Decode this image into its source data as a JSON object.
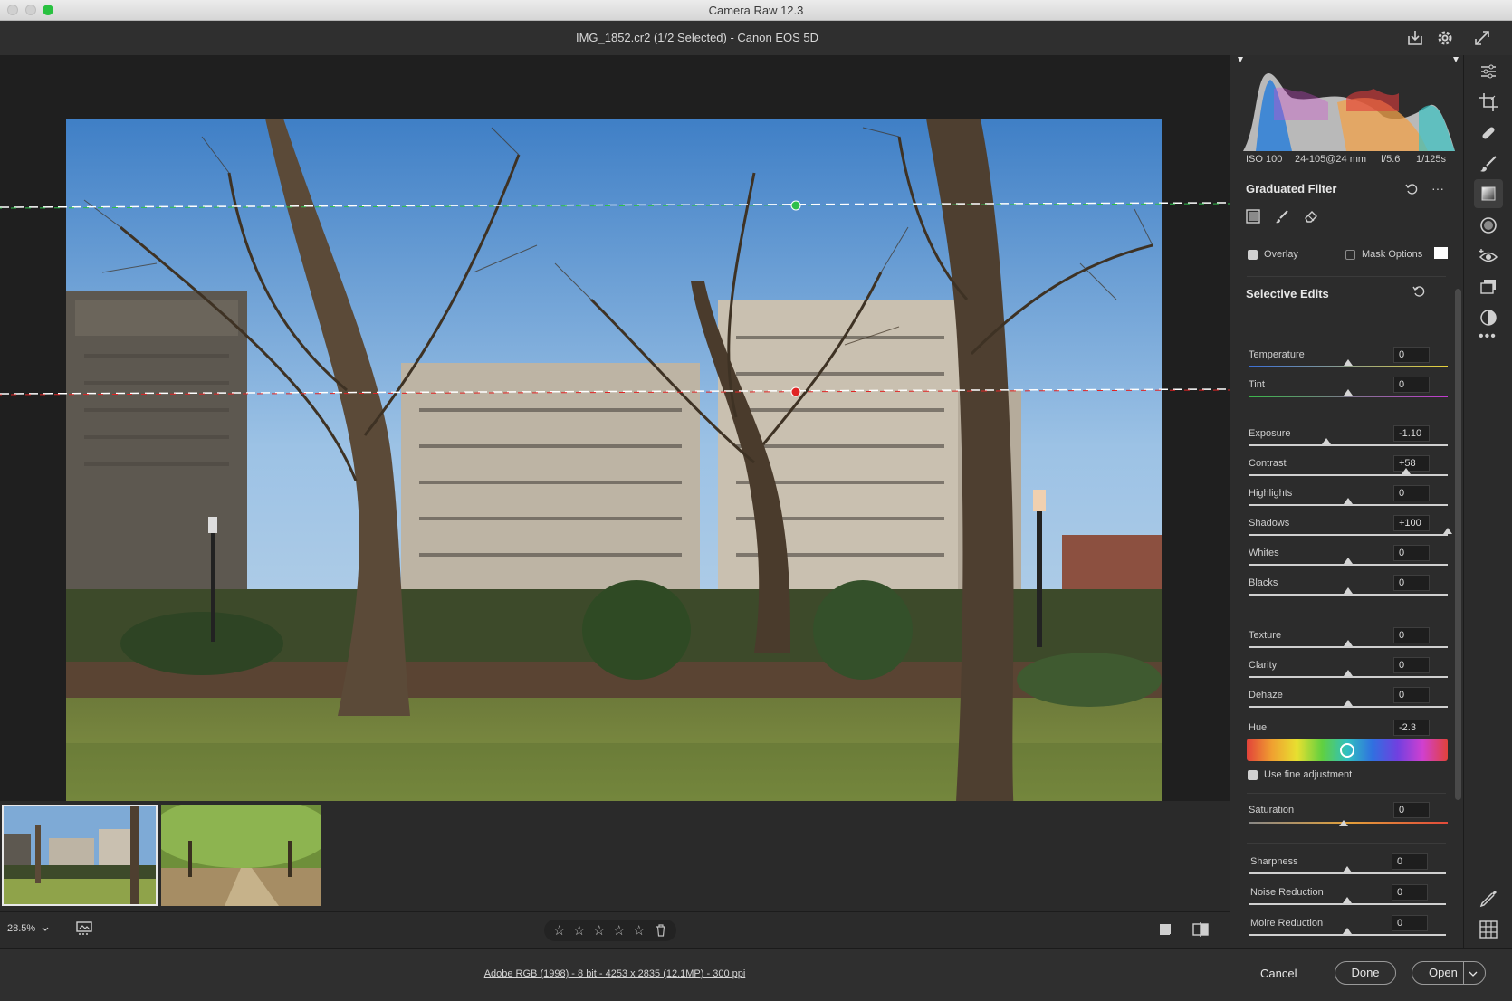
{
  "window": {
    "title": "Camera Raw 12.3"
  },
  "header": {
    "document_title": "IMG_1852.cr2 (1/2 Selected)  -  Canon EOS 5D"
  },
  "histogram": {
    "iso": "ISO 100",
    "lens": "24-105@24 mm",
    "aperture": "f/5.6",
    "shutter": "1/125s"
  },
  "graduated_filter": {
    "title": "Graduated Filter",
    "overlay_label": "Overlay",
    "overlay_checked": true,
    "mask_options_label": "Mask Options",
    "mask_options_checked": false
  },
  "selective_edits": {
    "title": "Selective Edits",
    "sliders": [
      {
        "label": "Temperature",
        "value": "0",
        "position": 0.5
      },
      {
        "label": "Tint",
        "value": "0",
        "position": 0.5
      },
      {
        "label": "Exposure",
        "value": "-1.10",
        "position": 0.39
      },
      {
        "label": "Contrast",
        "value": "+58",
        "position": 0.79
      },
      {
        "label": "Highlights",
        "value": "0",
        "position": 0.5
      },
      {
        "label": "Shadows",
        "value": "+100",
        "position": 1.0
      },
      {
        "label": "Whites",
        "value": "0",
        "position": 0.5
      },
      {
        "label": "Blacks",
        "value": "0",
        "position": 0.5
      },
      {
        "label": "Texture",
        "value": "0",
        "position": 0.5
      },
      {
        "label": "Clarity",
        "value": "0",
        "position": 0.5
      },
      {
        "label": "Dehaze",
        "value": "0",
        "position": 0.5
      }
    ],
    "hue": {
      "label": "Hue",
      "value": "-2.3",
      "position": 0.5
    },
    "fine_adjustment": {
      "label": "Use fine adjustment",
      "checked": true
    },
    "saturation": {
      "label": "Saturation",
      "value": "0",
      "position": 0.5
    },
    "detail": [
      {
        "label": "Sharpness",
        "value": "0",
        "position": 0.5
      },
      {
        "label": "Noise Reduction",
        "value": "0",
        "position": 0.5
      },
      {
        "label": "Moire Reduction",
        "value": "0",
        "position": 0.5
      }
    ]
  },
  "bottombar": {
    "zoom": "28.5%"
  },
  "footer": {
    "image_info": "Adobe RGB (1998) - 8 bit - 4253 x 2835 (12.1MP) - 300 ppi",
    "cancel": "Cancel",
    "done": "Done",
    "open": "Open"
  },
  "colors": {
    "accent_green": "#2fbf4a",
    "accent_red": "#e02424",
    "panel_bg": "#2c2c2c"
  }
}
